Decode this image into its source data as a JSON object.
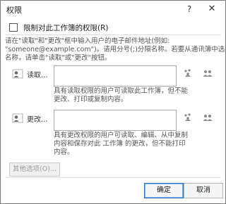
{
  "window": {
    "title": "权限",
    "help_label": "?",
    "close_label": "✕"
  },
  "restrict": {
    "label": "限制对此工作簿的权限(R)",
    "checked": false
  },
  "instructions": [
    "请在\"读取\"和\"更改\"框中输入用户的电子邮件地址(例如:",
    "\"someone@example.com\")。请用分号(;)分隔名称。若要从通讯簿中选择",
    "名称，请单击\"读取\"或\"更改\"按钮。"
  ],
  "read": {
    "label": "读取...",
    "value": "",
    "description": [
      "具有读取权限的用户可读取此工作簿，但不能",
      "更改、打印或复制内容。"
    ]
  },
  "change": {
    "label": "更改...",
    "value": "",
    "description": [
      "具有更改权限的用户可读取、编辑、从中复制",
      "内容和保存对此 工作簿 的更改，但不能打印",
      "内容。"
    ]
  },
  "more_options": {
    "label": "其他选项(O)..."
  },
  "buttons": {
    "ok": "确定",
    "cancel": "取消"
  },
  "icons": {
    "read_people": "person-icon",
    "everyone": "everyone-icon",
    "address_book": "address-book-icon"
  },
  "colors": {
    "accent_border": "#2b72c6",
    "disabled_text": "#9a9a9a"
  }
}
